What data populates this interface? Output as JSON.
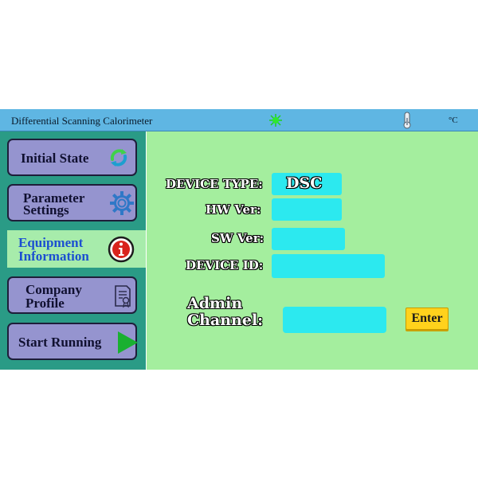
{
  "titlebar": {
    "title": "Differential Scanning Calorimeter",
    "status_led_icon": "green-led-icon",
    "thermometer_icon": "thermometer-icon",
    "temperature_unit": "°C"
  },
  "sidebar": {
    "items": [
      {
        "label": "Initial State",
        "icon": "refresh-icon",
        "active": false
      },
      {
        "label_line1": "Parameter",
        "label_line2": "Settings",
        "icon": "gear-icon",
        "active": false
      },
      {
        "label_line1": "Equipment",
        "label_line2": "Information",
        "icon": "info-icon",
        "active": true
      },
      {
        "label_line1": "Company",
        "label_line2": "Profile",
        "icon": "certificate-icon",
        "active": false
      },
      {
        "label": "Start Running",
        "icon": "play-icon",
        "active": false
      }
    ]
  },
  "info": {
    "device_type_label": "DEVICE TYPE:",
    "device_type_value": "DSC",
    "hw_ver_label": "HW Ver:",
    "hw_ver_value": "",
    "sw_ver_label": "SW Ver:",
    "sw_ver_value": "",
    "device_id_label": "DEVICE ID:",
    "device_id_value": ""
  },
  "admin": {
    "label_line1": "Admin",
    "label_line2": "Channel:",
    "input_value": "",
    "enter_label": "Enter"
  },
  "colors": {
    "titlebar": "#5fb6e3",
    "sidebar": "#2a9b86",
    "content": "#a4ee9e",
    "button": "#9594cf",
    "field": "#2ce9ef",
    "enter": "#ffd21c"
  }
}
